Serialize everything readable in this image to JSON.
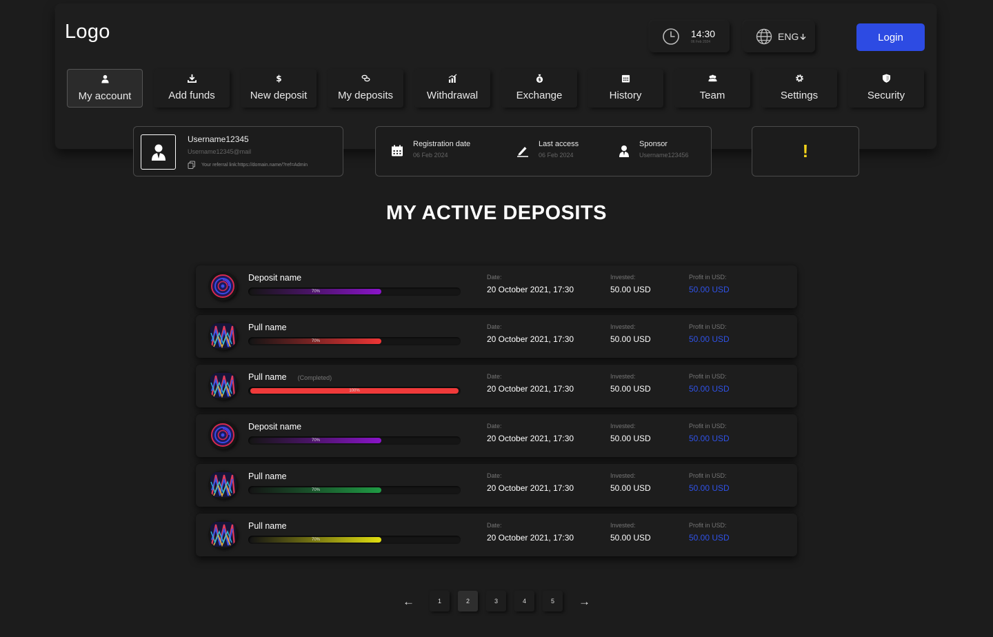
{
  "header": {
    "logo": "Logo",
    "clock": {
      "time": "14:30",
      "date": "06 Feb 2024"
    },
    "language": "ENG",
    "login_label": "Login"
  },
  "nav": [
    {
      "label": "My account",
      "icon": "user-icon",
      "active": true
    },
    {
      "label": "Add funds",
      "icon": "download-icon",
      "active": false
    },
    {
      "label": "New deposit",
      "icon": "dollar-icon",
      "active": false
    },
    {
      "label": "My deposits",
      "icon": "coins-icon",
      "active": false
    },
    {
      "label": "Withdrawal",
      "icon": "chart-icon",
      "active": false
    },
    {
      "label": "Exchange",
      "icon": "money-bag-icon",
      "active": false
    },
    {
      "label": "History",
      "icon": "calendar-icon",
      "active": false
    },
    {
      "label": "Team",
      "icon": "team-icon",
      "active": false
    },
    {
      "label": "Settings",
      "icon": "gear-icon",
      "active": false
    },
    {
      "label": "Security",
      "icon": "shield-icon",
      "active": false
    }
  ],
  "user_card": {
    "username": "Username12345",
    "email": "Username12345@mail",
    "referral": "Your referral link:https://domain.name/?ref=Admin"
  },
  "info_card": {
    "registration": {
      "label": "Registration date",
      "value": "06 Feb 2024"
    },
    "last_access": {
      "label": "Last access",
      "value": "06 Feb 2024"
    },
    "sponsor": {
      "label": "Sponsor",
      "value": "Username123456"
    }
  },
  "alert": {
    "symbol": "!"
  },
  "section_title": "MY ACTIVE DEPOSITS",
  "deposits": [
    {
      "name": "Deposit name",
      "status": "",
      "progress": 0.7,
      "progress_label": "70%",
      "color": "#8a14c9",
      "icon": "coin-logo-icon",
      "date_label": "Date:",
      "date": "20 October 2021, 17:30",
      "invested_label": "Invested:",
      "invested": "50.00 USD",
      "profit_label": "Profit in USD:",
      "profit": "50.00 USD"
    },
    {
      "name": "Pull name",
      "status": "",
      "progress": 0.7,
      "progress_label": "70%",
      "color": "#ef3535",
      "icon": "pattern-logo-icon",
      "date_label": "Date:",
      "date": "20 October 2021, 17:30",
      "invested_label": "Invested:",
      "invested": "50.00 USD",
      "profit_label": "Profit in USD:",
      "profit": "50.00 USD"
    },
    {
      "name": "Pull name",
      "status": "(Completed)",
      "progress": 1.0,
      "progress_label": "100%",
      "color": "#f03a3a",
      "icon": "pattern-logo-icon",
      "date_label": "Date:",
      "date": "20 October 2021, 17:30",
      "invested_label": "Invested:",
      "invested": "50.00 USD",
      "profit_label": "Profit in USD:",
      "profit": "50.00 USD"
    },
    {
      "name": "Deposit name",
      "status": "",
      "progress": 0.7,
      "progress_label": "70%",
      "color": "#8a14c9",
      "icon": "coin-logo-icon",
      "date_label": "Date:",
      "date": "20 October 2021, 17:30",
      "invested_label": "Invested:",
      "invested": "50.00 USD",
      "profit_label": "Profit in USD:",
      "profit": "50.00 USD"
    },
    {
      "name": "Pull name",
      "status": "",
      "progress": 0.7,
      "progress_label": "70%",
      "color": "#1f9b44",
      "icon": "pattern-logo-icon",
      "date_label": "Date:",
      "date": "20 October 2021, 17:30",
      "invested_label": "Invested:",
      "invested": "50.00 USD",
      "profit_label": "Profit in USD:",
      "profit": "50.00 USD"
    },
    {
      "name": "Pull name",
      "status": "",
      "progress": 0.7,
      "progress_label": "70%",
      "color": "#e1df10",
      "icon": "pattern-logo-icon",
      "date_label": "Date:",
      "date": "20 October 2021, 17:30",
      "invested_label": "Invested:",
      "invested": "50.00 USD",
      "profit_label": "Profit in USD:",
      "profit": "50.00 USD"
    }
  ],
  "pagination": {
    "prev": "←",
    "next": "→",
    "pages": [
      "1",
      "2",
      "3",
      "4",
      "5"
    ],
    "current": "2"
  },
  "colors": {
    "accent": "#2d4be3",
    "profit": "#2f52e8",
    "alert": "#f2d21b",
    "background": "#1c1c1c"
  }
}
